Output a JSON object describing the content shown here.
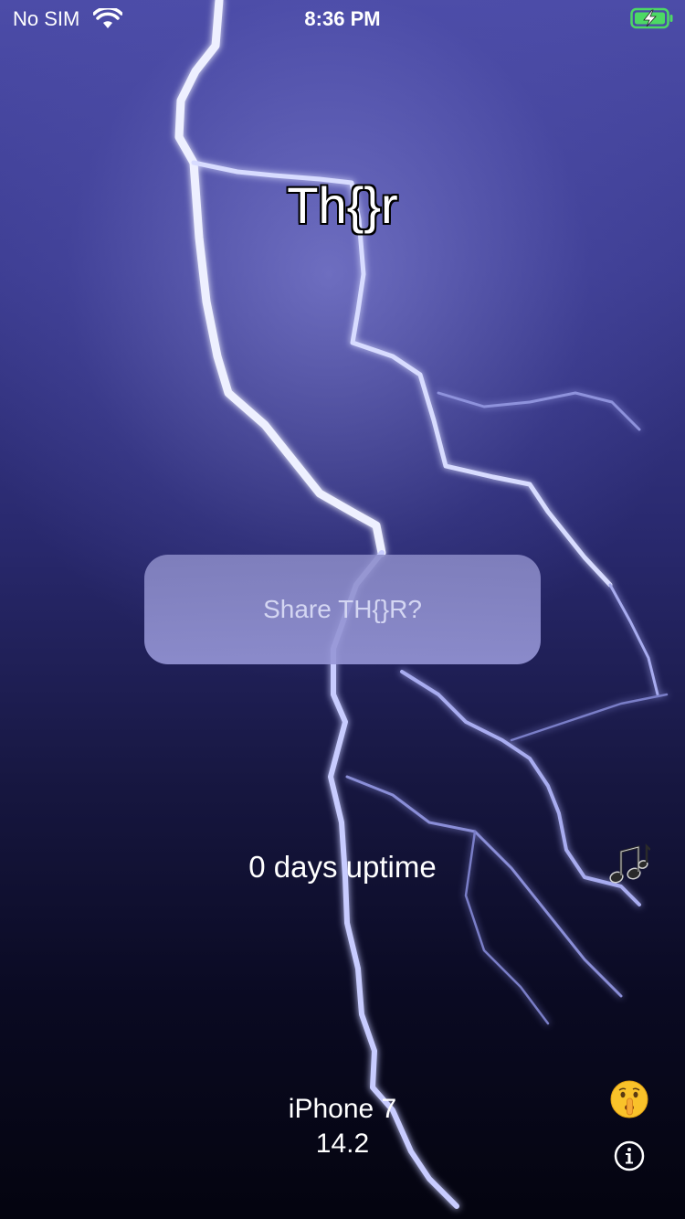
{
  "status_bar": {
    "carrier": "No SIM",
    "time": "8:36 PM",
    "wifi_icon": "wifi-icon",
    "battery_icon": "battery-charging-icon",
    "battery_color": "#4cd964"
  },
  "main": {
    "title": "Th{}r",
    "share_button_label": "Share TH{}R?",
    "uptime_text": "0 days uptime",
    "device_model": "iPhone 7",
    "ios_version": "14.2"
  },
  "icons": {
    "music": "music-notes-icon",
    "shush": "shushing-face-icon",
    "info": "info-icon"
  },
  "colors": {
    "background_top": "#4c4ca8",
    "background_bottom": "#04040f",
    "button_fill": "#8c8cc8",
    "button_text": "#d4d6f2"
  }
}
